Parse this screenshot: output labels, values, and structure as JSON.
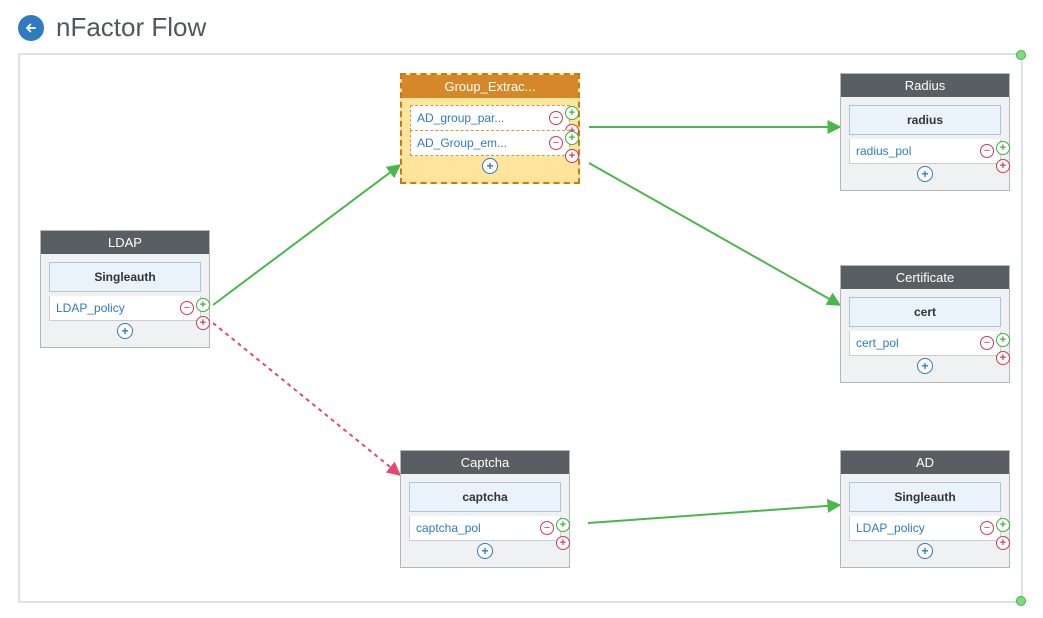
{
  "header": {
    "title": "nFactor Flow"
  },
  "nodes": {
    "ldap": {
      "title": "LDAP",
      "schema": "Singleauth",
      "policies": [
        "LDAP_policy"
      ]
    },
    "group_extract": {
      "title": "Group_Extrac...",
      "policies": [
        "AD_group_par...",
        "AD_Group_em..."
      ]
    },
    "captcha": {
      "title": "Captcha",
      "schema": "captcha",
      "policies": [
        "captcha_pol"
      ]
    },
    "radius": {
      "title": "Radius",
      "schema": "radius",
      "policies": [
        "radius_pol"
      ]
    },
    "certificate": {
      "title": "Certificate",
      "schema": "cert",
      "policies": [
        "cert_pol"
      ]
    },
    "ad": {
      "title": "AD",
      "schema": "Singleauth",
      "policies": [
        "LDAP_policy"
      ]
    }
  },
  "icons": {
    "plus": "+",
    "minus": "−"
  }
}
